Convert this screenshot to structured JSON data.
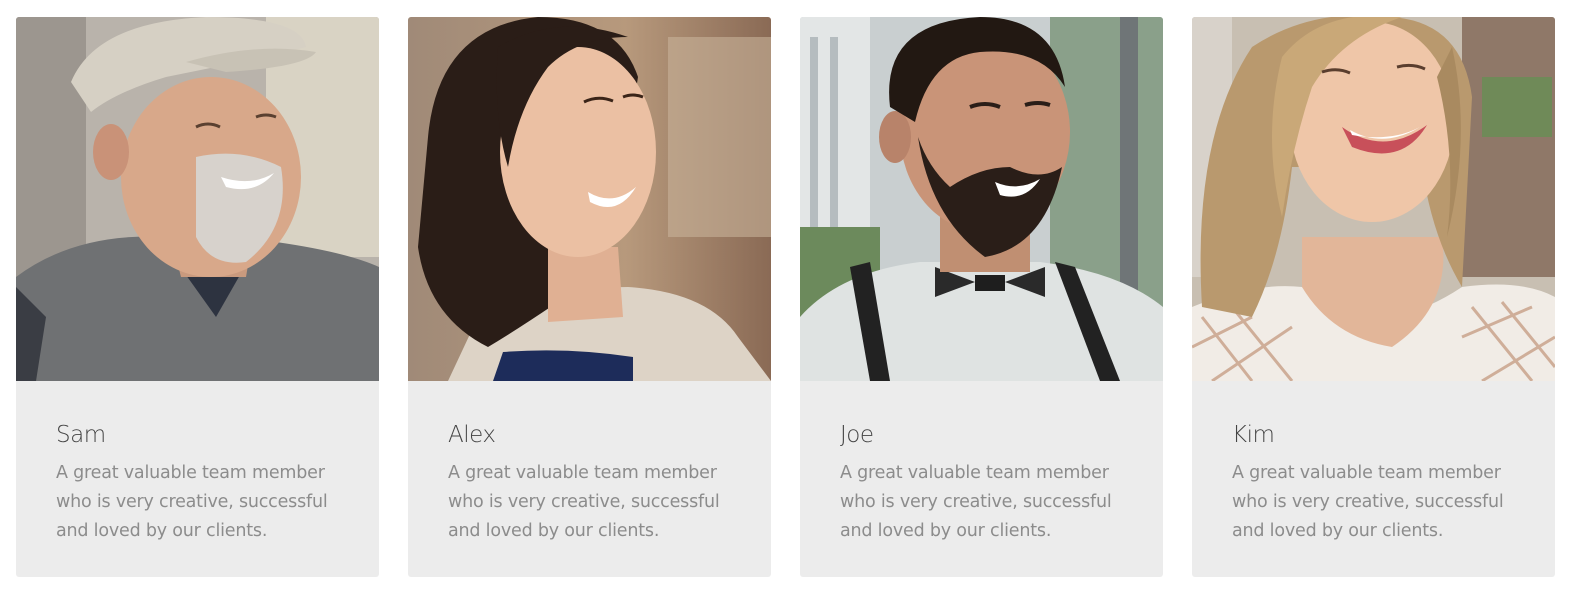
{
  "team": {
    "members": [
      {
        "name": "Sam",
        "bio": "A great valuable team member who is very creative, successful and loved by our clients.",
        "photo_icon": "portrait-photo-older-man-cap"
      },
      {
        "name": "Alex",
        "bio": "A great valuable team member who is very creative, successful and loved by our clients.",
        "photo_icon": "portrait-photo-young-woman"
      },
      {
        "name": "Joe",
        "bio": "A great valuable team member who is very creative, successful and loved by our clients.",
        "photo_icon": "portrait-photo-bearded-man"
      },
      {
        "name": "Kim",
        "bio": "A great valuable team member who is very creative, successful and loved by our clients.",
        "photo_icon": "portrait-photo-blonde-woman"
      }
    ]
  },
  "colors": {
    "card_background": "#ececec",
    "name_text": "#444444",
    "bio_text": "#8c8c8c",
    "page_background": "#ffffff"
  }
}
